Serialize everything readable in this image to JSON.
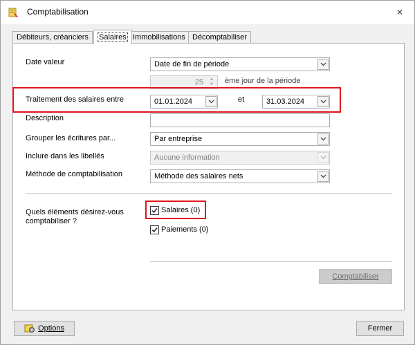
{
  "window": {
    "title": "Comptabilisation"
  },
  "tabs": [
    {
      "label": "Débiteurs, créanciers"
    },
    {
      "label": "Salaires"
    },
    {
      "label": "Immobilisations"
    },
    {
      "label": "Décomptabiliser"
    }
  ],
  "form": {
    "date_valeur_label": "Date valeur",
    "date_valeur_value": "Date de fin de période",
    "day_value": "25",
    "day_suffix": "ème jour de la période",
    "traitement_label": "Traitement des salaires entre",
    "date_from": "01.01.2024",
    "et_label": "et",
    "date_to": "31.03.2024",
    "description_label": "Description",
    "description_value": "",
    "grouper_label": "Grouper les écritures par...",
    "grouper_value": "Par entreprise",
    "inclure_label": "Inclure dans les libellés",
    "inclure_value": "Aucune information",
    "methode_label": "Méthode de comptabilisation",
    "methode_value": "Méthode des salaires nets",
    "elements_label_line1": "Quels éléments désirez-vous",
    "elements_label_line2": "comptabiliser ?",
    "salaires_label": "Salaires (0)",
    "salaires_checked": true,
    "paiements_label": "Paiements (0)",
    "paiements_checked": true,
    "comptabiliser_button": "Comptabiliser"
  },
  "footer": {
    "options_button": "Options",
    "fermer_button": "Fermer"
  }
}
